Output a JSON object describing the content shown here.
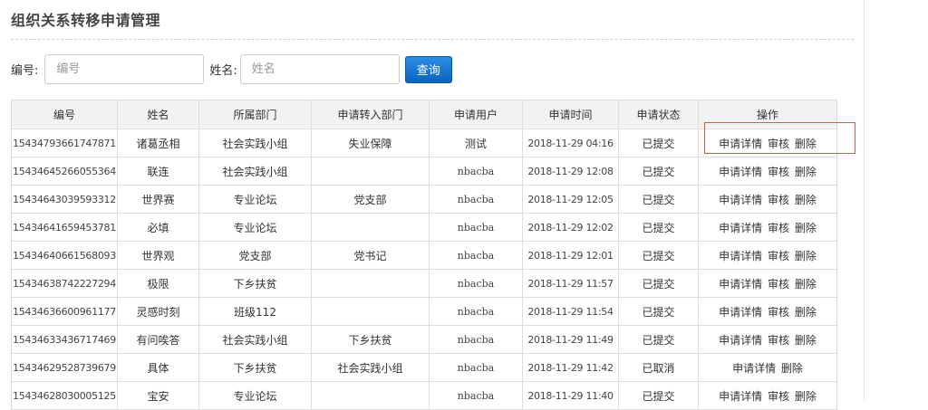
{
  "page": {
    "title": "组织关系转移申请管理"
  },
  "search": {
    "number_label": "编号:",
    "number_placeholder": "编号",
    "name_label": "姓名:",
    "name_placeholder": "姓名",
    "query_label": "查询"
  },
  "table": {
    "headers": [
      "编号",
      "姓名",
      "所属部门",
      "申请转入部门",
      "申请用户",
      "申请时间",
      "申请状态",
      "操作"
    ],
    "rows": [
      {
        "id": "15434793661747871",
        "name": "诸葛丞相",
        "dept": "社会实践小组",
        "target": "失业保障",
        "user": "测试",
        "time": "2018-11-29 04:16",
        "status": "已提交",
        "actions": [
          "申请详情",
          "审核",
          "删除"
        ]
      },
      {
        "id": "15434645266055364",
        "name": "联连",
        "dept": "社会实践小组",
        "target": "",
        "user": "nbacba",
        "time": "2018-11-29 12:08",
        "status": "已提交",
        "actions": [
          "申请详情",
          "审核",
          "删除"
        ]
      },
      {
        "id": "15434643039593312",
        "name": "世界赛",
        "dept": "专业论坛",
        "target": "党支部",
        "user": "nbacba",
        "time": "2018-11-29 12:05",
        "status": "已提交",
        "actions": [
          "申请详情",
          "审核",
          "删除"
        ]
      },
      {
        "id": "15434641659453781",
        "name": "必填",
        "dept": "专业论坛",
        "target": "",
        "user": "nbacba",
        "time": "2018-11-29 12:02",
        "status": "已提交",
        "actions": [
          "申请详情",
          "审核",
          "删除"
        ]
      },
      {
        "id": "15434640661568093",
        "name": "世界观",
        "dept": "党支部",
        "target": "党书记",
        "user": "nbacba",
        "time": "2018-11-29 12:01",
        "status": "已提交",
        "actions": [
          "申请详情",
          "审核",
          "删除"
        ]
      },
      {
        "id": "15434638742227294",
        "name": "极限",
        "dept": "下乡扶贫",
        "target": "",
        "user": "nbacba",
        "time": "2018-11-29 11:57",
        "status": "已提交",
        "actions": [
          "申请详情",
          "审核",
          "删除"
        ]
      },
      {
        "id": "15434636600961177",
        "name": "灵感时刻",
        "dept": "班级112",
        "target": "",
        "user": "nbacba",
        "time": "2018-11-29 11:54",
        "status": "已提交",
        "actions": [
          "申请详情",
          "审核",
          "删除"
        ]
      },
      {
        "id": "15434633436717469",
        "name": "有问唉答",
        "dept": "社会实践小组",
        "target": "下乡扶贫",
        "user": "nbacba",
        "time": "2018-11-29 11:49",
        "status": "已提交",
        "actions": [
          "申请详情",
          "审核",
          "删除"
        ]
      },
      {
        "id": "15434629528739679",
        "name": "具体",
        "dept": "下乡扶贫",
        "target": "社会实践小组",
        "user": "nbacba",
        "time": "2018-11-29 11:42",
        "status": "已取消",
        "actions": [
          "申请详情",
          "删除"
        ]
      },
      {
        "id": "15434628030005125",
        "name": "宝安",
        "dept": "专业论坛",
        "target": "",
        "user": "nbacba",
        "time": "2018-11-29 11:40",
        "status": "已提交",
        "actions": [
          "申请详情",
          "审核",
          "删除"
        ]
      }
    ]
  },
  "colors": {
    "primary_button": "#0a64c2",
    "highlight_border": "#d9534f",
    "header_bg": "#f2f2f2"
  }
}
